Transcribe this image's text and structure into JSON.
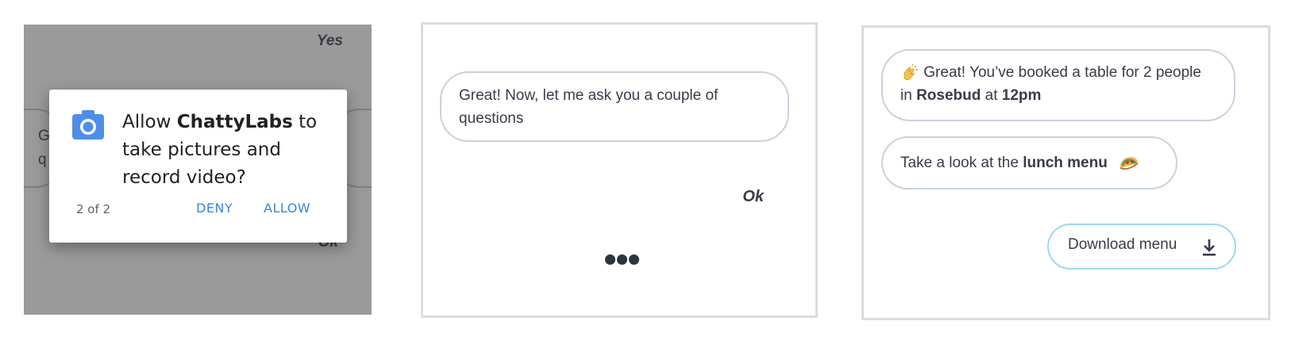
{
  "panel1": {
    "bg_reply_top": "Yes",
    "bg_bubble_fragment": [
      "G",
      "q"
    ],
    "bg_reply_bottom": "Ok",
    "dialog": {
      "title_prefix": "Allow ",
      "app_name": "ChattyLabs",
      "title_suffix": " to take pictures and record video?",
      "counter": "2 of 2",
      "deny_label": "DENY",
      "allow_label": "ALLOW",
      "icon": "camera-icon",
      "accent_color": "#3b82e0"
    }
  },
  "panel2": {
    "bot_message": "Great! Now, let me ask you a couple of questions",
    "user_reply": "Ok",
    "typing_indicator": "typing-dots-icon"
  },
  "panel3": {
    "booking": {
      "emoji": "clapping-hands-icon",
      "text_1": " Great! You’ve booked a table for 2 people in ",
      "restaurant": "Rosebud",
      "text_2": " at ",
      "time": "12pm"
    },
    "menu_message": {
      "text": "Take a look at the ",
      "link": "lunch menu",
      "emoji": "taco-icon"
    },
    "download_button": {
      "label": "Download menu",
      "icon": "download-icon",
      "border_color": "#9ad9ef"
    }
  }
}
